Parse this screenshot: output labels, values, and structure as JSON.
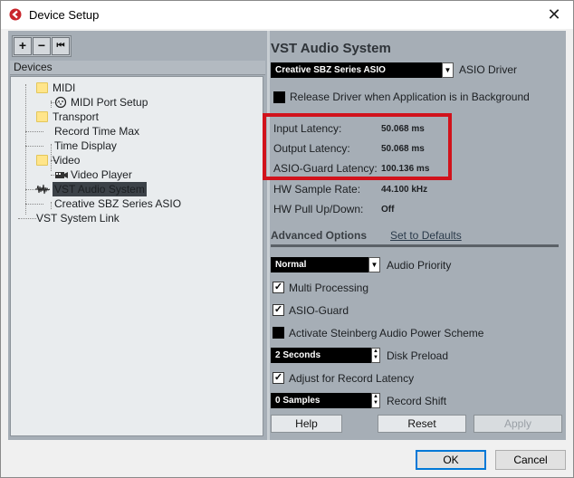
{
  "window": {
    "title": "Device Setup",
    "close_glyph": "✕"
  },
  "toolbar": {
    "add": "+",
    "remove": "−",
    "reset": "⏮"
  },
  "devices": {
    "header": "Devices",
    "items": [
      {
        "label": "MIDI"
      },
      {
        "label": "MIDI Port Setup"
      },
      {
        "label": "Transport"
      },
      {
        "label": "Record Time Max"
      },
      {
        "label": "Time Display"
      },
      {
        "label": "Video"
      },
      {
        "label": "Video Player"
      },
      {
        "label": "VST Audio System"
      },
      {
        "label": "Creative SBZ Series ASIO"
      },
      {
        "label": "VST System Link"
      }
    ]
  },
  "vst": {
    "title": "VST Audio System",
    "asio_driver_value": "Creative SBZ Series ASIO",
    "asio_driver_label": "ASIO Driver",
    "release_driver_label": "Release Driver when Application is in Background",
    "release_driver_checked": false,
    "input_latency_label": "Input Latency:",
    "input_latency_value": "50.068 ms",
    "output_latency_label": "Output Latency:",
    "output_latency_value": "50.068 ms",
    "asio_guard_latency_label": "ASIO-Guard Latency:",
    "asio_guard_latency_value": "100.136 ms",
    "hw_sample_rate_label": "HW Sample Rate:",
    "hw_sample_rate_value": "44.100 kHz",
    "hw_pull_label": "HW Pull Up/Down:",
    "hw_pull_value": "Off"
  },
  "advanced": {
    "tab_label": "Advanced Options",
    "defaults_link": "Set to Defaults",
    "audio_priority_value": "Normal",
    "audio_priority_label": "Audio Priority",
    "multi_processing_label": "Multi Processing",
    "multi_processing_checked": true,
    "asio_guard_label": "ASIO-Guard",
    "asio_guard_checked": true,
    "power_scheme_label": "Activate Steinberg Audio Power Scheme",
    "power_scheme_checked": false,
    "disk_preload_value": "2 Seconds",
    "disk_preload_label": "Disk Preload",
    "adjust_latency_label": "Adjust for Record Latency",
    "adjust_latency_checked": true,
    "record_shift_value": "0 Samples",
    "record_shift_label": "Record Shift"
  },
  "panel_buttons": {
    "help": "Help",
    "reset": "Reset",
    "apply": "Apply"
  },
  "footer": {
    "ok": "OK",
    "cancel": "Cancel"
  },
  "colors": {
    "highlight": "#d1121b",
    "panel": "#a6aeb6",
    "accent": "#0078d7"
  },
  "icons": {
    "check": "✓",
    "dropdown": "▼",
    "spin_up": "▲",
    "spin_down": "▼"
  }
}
